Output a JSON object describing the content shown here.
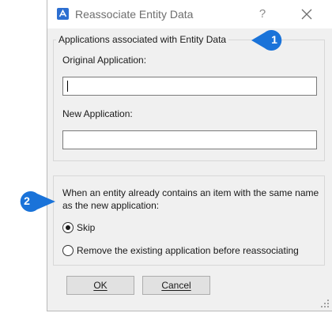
{
  "dialog": {
    "title": "Reassociate Entity Data",
    "help_glyph": "?",
    "icons": {
      "app": "app-logo-icon",
      "close": "close-icon",
      "grip": "resize-grip-icon"
    }
  },
  "group_apps": {
    "legend": "Applications associated with Entity Data",
    "original_label": "Original Application:",
    "original_value": "",
    "new_label": "New Application:",
    "new_value": ""
  },
  "group_conflict": {
    "message": "When an entity already contains an item with the same name as the new application:",
    "options": [
      {
        "label": "Skip",
        "checked": true
      },
      {
        "label": "Remove the existing application before reassociating",
        "checked": false
      }
    ]
  },
  "buttons": {
    "ok": "OK",
    "cancel": "Cancel"
  },
  "callouts": [
    "1",
    "2"
  ],
  "colors": {
    "callout": "#1a73d9",
    "dialog_bg": "#f0f0f0",
    "accent_icon": "#2d6fd1"
  }
}
